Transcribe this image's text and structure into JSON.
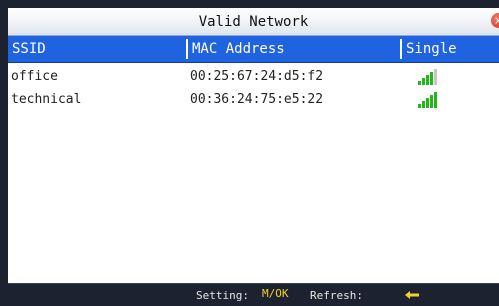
{
  "window": {
    "title": "Valid Network",
    "close_symbol": "×"
  },
  "columns": [
    "SSID",
    "MAC Address",
    "Single"
  ],
  "networks": [
    {
      "ssid": "office",
      "mac": "00:25:67:24:d5:f2",
      "signal_bars": 4,
      "signal_max": 5
    },
    {
      "ssid": "technical",
      "mac": "00:36:24:75:e5:22",
      "signal_bars": 5,
      "signal_max": 5
    }
  ],
  "status_bar": {
    "setting_label": "Setting:",
    "setting_key": "M/OK",
    "refresh_label": "Refresh:",
    "refresh_icon": "arrow-left-icon"
  },
  "colors": {
    "header_bg": "#1f63e0",
    "signal_on": "#22b61a",
    "signal_off": "#c6c6c6",
    "key_yellow": "#f2d22a"
  }
}
